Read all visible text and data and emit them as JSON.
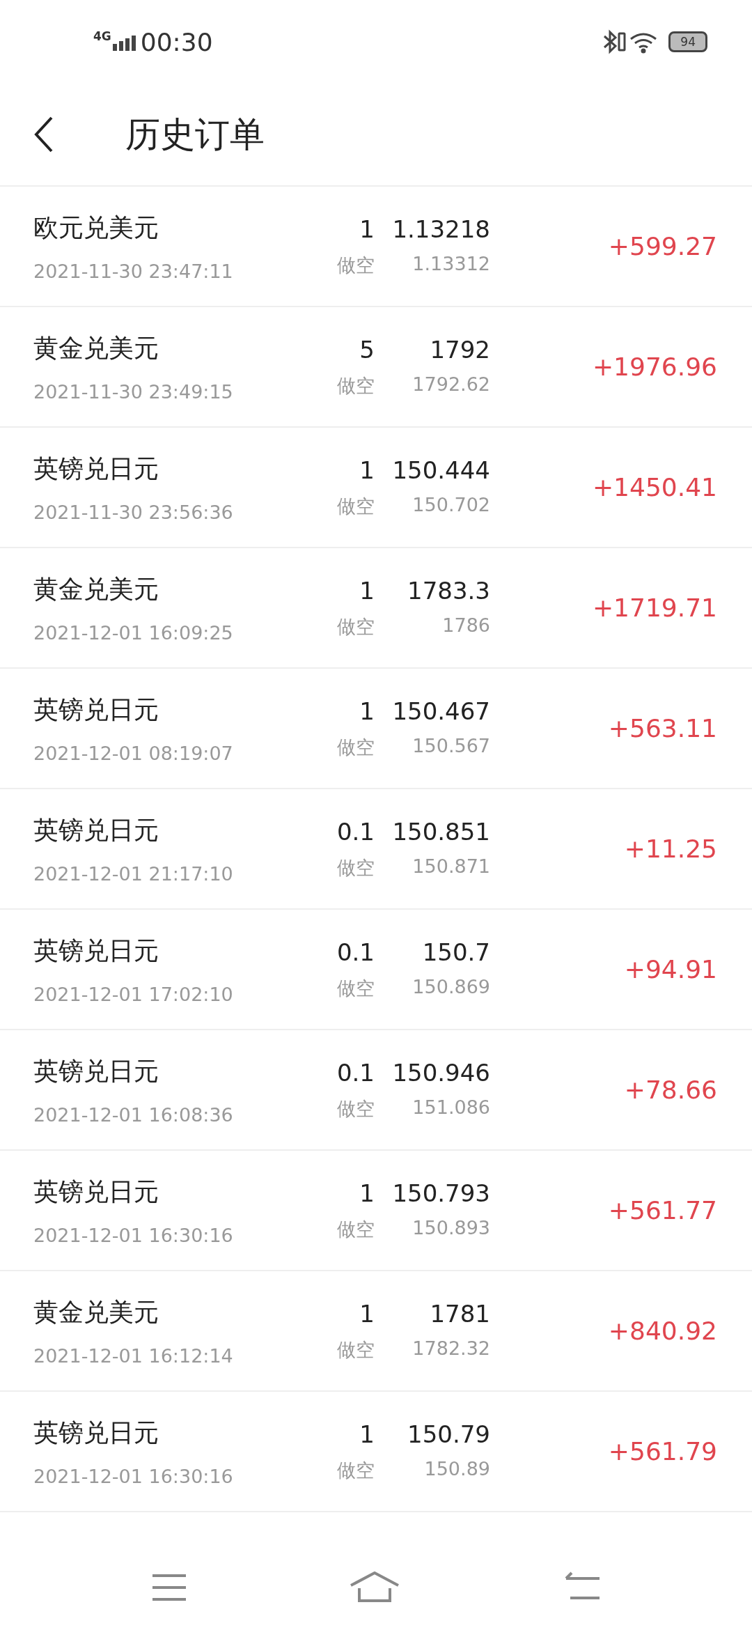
{
  "status_bar": {
    "network": "4G",
    "time": "00:30",
    "battery": "94"
  },
  "header": {
    "title": "历史订单"
  },
  "orders": [
    {
      "name": "欧元兑美元",
      "time": "2021-11-30 23:47:11",
      "lots": "1",
      "open_price": "1.13218",
      "direction": "做空",
      "close_price": "1.13312",
      "profit": "+599.27"
    },
    {
      "name": "黄金兑美元",
      "time": "2021-11-30 23:49:15",
      "lots": "5",
      "open_price": "1792",
      "direction": "做空",
      "close_price": "1792.62",
      "profit": "+1976.96"
    },
    {
      "name": "英镑兑日元",
      "time": "2021-11-30 23:56:36",
      "lots": "1",
      "open_price": "150.444",
      "direction": "做空",
      "close_price": "150.702",
      "profit": "+1450.41"
    },
    {
      "name": "黄金兑美元",
      "time": "2021-12-01 16:09:25",
      "lots": "1",
      "open_price": "1783.3",
      "direction": "做空",
      "close_price": "1786",
      "profit": "+1719.71"
    },
    {
      "name": "英镑兑日元",
      "time": "2021-12-01 08:19:07",
      "lots": "1",
      "open_price": "150.467",
      "direction": "做空",
      "close_price": "150.567",
      "profit": "+563.11"
    },
    {
      "name": "英镑兑日元",
      "time": "2021-12-01 21:17:10",
      "lots": "0.1",
      "open_price": "150.851",
      "direction": "做空",
      "close_price": "150.871",
      "profit": "+11.25"
    },
    {
      "name": "英镑兑日元",
      "time": "2021-12-01 17:02:10",
      "lots": "0.1",
      "open_price": "150.7",
      "direction": "做空",
      "close_price": "150.869",
      "profit": "+94.91"
    },
    {
      "name": "英镑兑日元",
      "time": "2021-12-01 16:08:36",
      "lots": "0.1",
      "open_price": "150.946",
      "direction": "做空",
      "close_price": "151.086",
      "profit": "+78.66"
    },
    {
      "name": "英镑兑日元",
      "time": "2021-12-01 16:30:16",
      "lots": "1",
      "open_price": "150.793",
      "direction": "做空",
      "close_price": "150.893",
      "profit": "+561.77"
    },
    {
      "name": "黄金兑美元",
      "time": "2021-12-01 16:12:14",
      "lots": "1",
      "open_price": "1781",
      "direction": "做空",
      "close_price": "1782.32",
      "profit": "+840.92"
    },
    {
      "name": "英镑兑日元",
      "time": "2021-12-01 16:30:16",
      "lots": "1",
      "open_price": "150.79",
      "direction": "做空",
      "close_price": "150.89",
      "profit": "+561.79"
    }
  ]
}
